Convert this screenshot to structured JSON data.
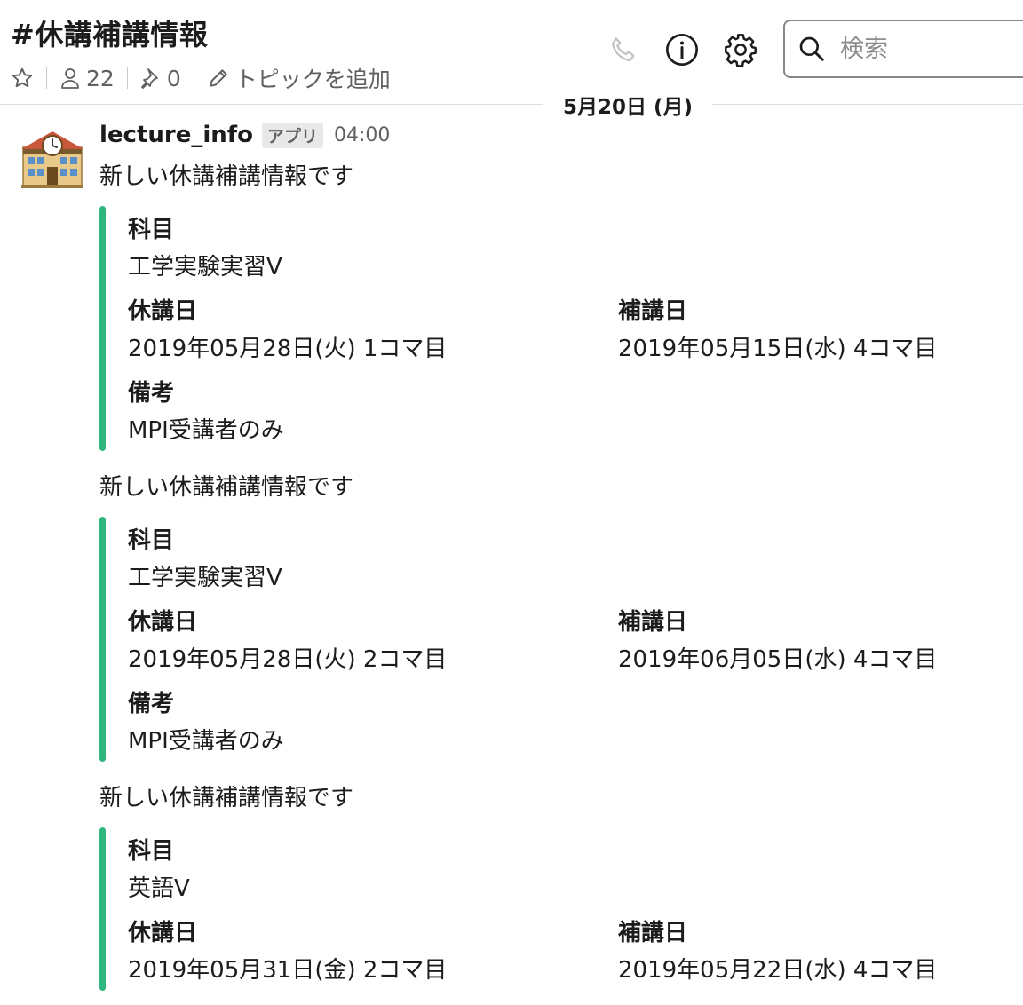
{
  "channel": {
    "title": "#休講補講情報",
    "member_count": "22",
    "pin_count": "0",
    "topic_label": "トピックを追加"
  },
  "search": {
    "placeholder": "検索"
  },
  "date_divider": "5月20日 (月)",
  "message": {
    "sender": "lecture_info",
    "badge": "アプリ",
    "time": "04:00",
    "avatar_icon": "school-building-icon",
    "accent_color": "#2eb67d",
    "posts": [
      {
        "text": "新しい休講補講情報です",
        "subject_label": "科目",
        "subject": "工学実験実習V",
        "cancel_label": "休講日",
        "cancel": "2019年05月28日(火) 1コマ目",
        "makeup_label": "補講日",
        "makeup": "2019年05月15日(水) 4コマ目",
        "note_label": "備考",
        "note": "MPI受講者のみ"
      },
      {
        "text": "新しい休講補講情報です",
        "subject_label": "科目",
        "subject": "工学実験実習V",
        "cancel_label": "休講日",
        "cancel": "2019年05月28日(火) 2コマ目",
        "makeup_label": "補講日",
        "makeup": "2019年06月05日(水) 4コマ目",
        "note_label": "備考",
        "note": "MPI受講者のみ"
      },
      {
        "text": "新しい休講補講情報です",
        "subject_label": "科目",
        "subject": "英語V",
        "cancel_label": "休講日",
        "cancel": "2019年05月31日(金) 2コマ目",
        "makeup_label": "補講日",
        "makeup": "2019年05月22日(水) 4コマ目"
      }
    ]
  }
}
